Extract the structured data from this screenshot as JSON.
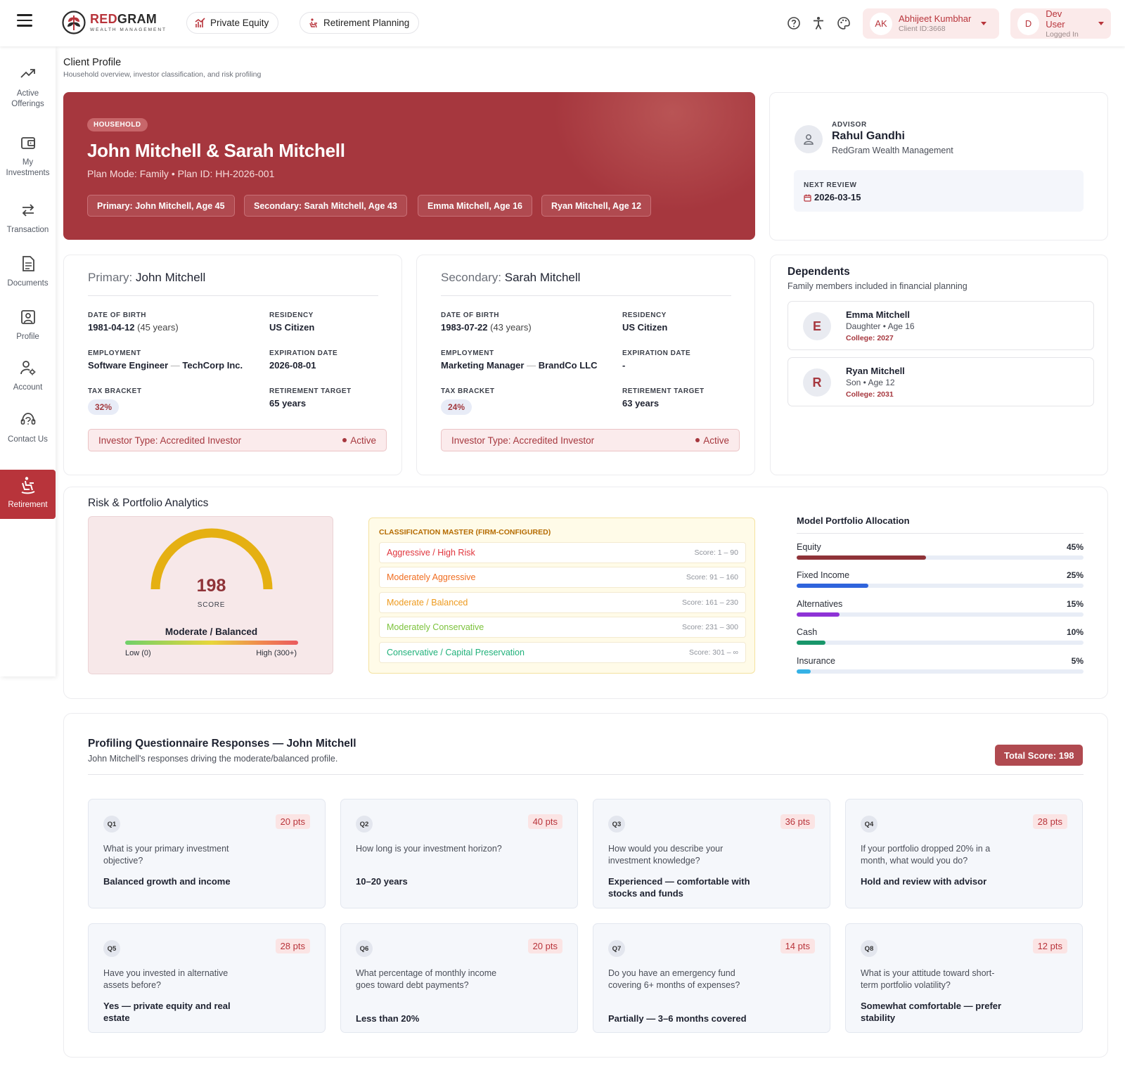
{
  "brand": {
    "name_red": "RED",
    "name_dark": "GRAM",
    "tagline": "WEALTH MANAGEMENT",
    "accent": "#b8343b"
  },
  "topbar": {
    "tabs": [
      {
        "label": "Private Equity",
        "icon": "chart-icon"
      },
      {
        "label": "Retirement Planning",
        "icon": "retirement-icon"
      }
    ],
    "icons": [
      "help-icon",
      "accessibility-icon",
      "palette-icon"
    ],
    "client_user": {
      "initials": "AK",
      "name": "Abhijeet Kumbhar",
      "sub": "Client ID:3668"
    },
    "dev_user": {
      "initials": "D",
      "name": "Dev User",
      "sub": "Logged In"
    }
  },
  "sidebar": {
    "items": [
      {
        "label": "Active Offerings",
        "icon": "trending-up-icon"
      },
      {
        "label": "My Investments",
        "icon": "wallet-icon"
      },
      {
        "label": "Transaction",
        "icon": "arrows-icon"
      },
      {
        "label": "Documents",
        "icon": "document-icon"
      },
      {
        "label": "Profile",
        "icon": "profile-icon"
      },
      {
        "label": "Account",
        "icon": "account-settings-icon"
      },
      {
        "label": "Contact Us",
        "icon": "support-icon"
      },
      {
        "label": "Retirement",
        "icon": "retirement-chair-icon",
        "active": true
      }
    ]
  },
  "header": {
    "title": "Client Profile",
    "subtitle": "Household overview, investor classification, and risk profiling"
  },
  "household": {
    "badge": "HOUSEHOLD",
    "name": "John Mitchell & Sarah Mitchell",
    "plan": "Plan Mode: Family • Plan ID: HH-2026-001",
    "members": [
      "Primary: John Mitchell, Age 45",
      "Secondary: Sarah Mitchell, Age 43",
      "Emma Mitchell, Age 16",
      "Ryan Mitchell, Age 12"
    ]
  },
  "advisor": {
    "label": "ADVISOR",
    "name": "Rahul Gandhi",
    "firm": "RedGram Wealth Management",
    "next_review_label": "NEXT REVIEW",
    "next_review": "2026-03-15"
  },
  "primary": {
    "role": "Primary:",
    "name": "John Mitchell",
    "dob_label": "DATE OF BIRTH",
    "dob": "1981-04-12",
    "age": "(45 years)",
    "residency_label": "RESIDENCY",
    "residency": "US Citizen",
    "employment_label": "EMPLOYMENT",
    "job": "Software Engineer",
    "employer": "TechCorp Inc.",
    "expiration_label": "EXPIRATION DATE",
    "expiration": "2026-08-01",
    "tax_label": "TAX BRACKET",
    "tax": "32%",
    "retire_label": "RETIREMENT TARGET",
    "retire": "65 years",
    "investor_type": "Investor Type: Accredited Investor",
    "status": "Active"
  },
  "secondary": {
    "role": "Secondary:",
    "name": "Sarah Mitchell",
    "dob_label": "DATE OF BIRTH",
    "dob": "1983-07-22",
    "age": "(43 years)",
    "residency_label": "RESIDENCY",
    "residency": "US Citizen",
    "employment_label": "EMPLOYMENT",
    "job": "Marketing Manager",
    "employer": "BrandCo LLC",
    "expiration_label": "EXPIRATION DATE",
    "expiration": "-",
    "tax_label": "TAX BRACKET",
    "tax": "24%",
    "retire_label": "RETIREMENT TARGET",
    "retire": "63 years",
    "investor_type": "Investor Type: Accredited Investor",
    "status": "Active"
  },
  "dependents": {
    "title": "Dependents",
    "subtitle": "Family members included in financial planning",
    "items": [
      {
        "initial": "E",
        "name": "Emma Mitchell",
        "relation": "Daughter • Age 16",
        "college": "College: 2027"
      },
      {
        "initial": "R",
        "name": "Ryan Mitchell",
        "relation": "Son • Age 12",
        "college": "College: 2031"
      }
    ]
  },
  "analytics": {
    "title": "Risk & Portfolio Analytics",
    "score": "198",
    "score_label": "SCORE",
    "score_fraction": 0.66,
    "profile": "Moderate / Balanced",
    "low_label": "Low (0)",
    "high_label": "High (300+)",
    "gauge_color": "#e5b012",
    "classification_title": "CLASSIFICATION MASTER (FIRM-CONFIGURED)",
    "classes": [
      {
        "name": "Aggressive / High Risk",
        "score": "Score: 1 – 90",
        "color": "#e0353d"
      },
      {
        "name": "Moderately Aggressive",
        "score": "Score: 91 – 160",
        "color": "#f06d20"
      },
      {
        "name": "Moderate / Balanced",
        "score": "Score: 161 – 230",
        "color": "#ee9a1d"
      },
      {
        "name": "Moderately Conservative",
        "score": "Score: 231 – 300",
        "color": "#7cc23c"
      },
      {
        "name": "Conservative / Capital Preservation",
        "score": "Score: 301 – ∞",
        "color": "#20b17a"
      }
    ],
    "allocation_title": "Model Portfolio Allocation",
    "allocation": [
      {
        "name": "Equity",
        "pct": "45%",
        "value": 45,
        "color": "#8f3338"
      },
      {
        "name": "Fixed Income",
        "pct": "25%",
        "value": 25,
        "color": "#2f64dc"
      },
      {
        "name": "Alternatives",
        "pct": "15%",
        "value": 15,
        "color": "#8e33d6"
      },
      {
        "name": "Cash",
        "pct": "10%",
        "value": 10,
        "color": "#18966a"
      },
      {
        "name": "Insurance",
        "pct": "5%",
        "value": 5,
        "color": "#35b2e6"
      }
    ]
  },
  "questionnaire": {
    "title": "Profiling Questionnaire Responses — John Mitchell",
    "subtitle": "John Mitchell's responses driving the moderate/balanced profile.",
    "total": "Total Score: 198",
    "questions": [
      {
        "id": "Q1",
        "pts": "20 pts",
        "q": "What is your primary investment objective?",
        "a": "Balanced growth and income"
      },
      {
        "id": "Q2",
        "pts": "40 pts",
        "q": "How long is your investment horizon?",
        "a": "10–20 years"
      },
      {
        "id": "Q3",
        "pts": "36 pts",
        "q": "How would you describe your investment knowledge?",
        "a": "Experienced — comfortable with stocks and funds"
      },
      {
        "id": "Q4",
        "pts": "28 pts",
        "q": "If your portfolio dropped 20% in a month, what would you do?",
        "a": "Hold and review with advisor"
      },
      {
        "id": "Q5",
        "pts": "28 pts",
        "q": "Have you invested in alternative assets before?",
        "a": "Yes — private equity and real estate"
      },
      {
        "id": "Q6",
        "pts": "20 pts",
        "q": "What percentage of monthly income goes toward debt payments?",
        "a": "Less than 20%"
      },
      {
        "id": "Q7",
        "pts": "14 pts",
        "q": "Do you have an emergency fund covering 6+ months of expenses?",
        "a": "Partially — 3–6 months covered"
      },
      {
        "id": "Q8",
        "pts": "12 pts",
        "q": "What is your attitude toward short-term portfolio volatility?",
        "a": "Somewhat comfortable — prefer stability"
      }
    ]
  }
}
